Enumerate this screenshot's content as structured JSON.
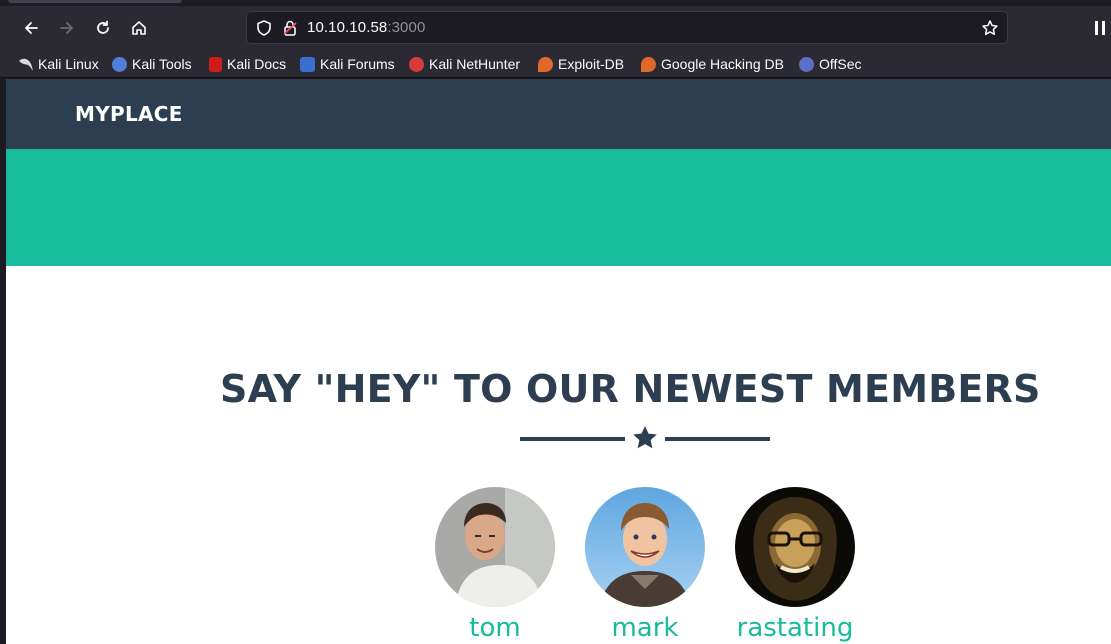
{
  "browser": {
    "url_host": "10.10.10.58",
    "url_port": ":3000",
    "bookmarks": [
      {
        "label": "Kali Linux",
        "icon": "kali-dragon-icon",
        "color": "#111111"
      },
      {
        "label": "Kali Tools",
        "icon": "kali-tools-icon",
        "color": "#4f7fd8"
      },
      {
        "label": "Kali Docs",
        "icon": "kali-docs-icon",
        "color": "#d11a1a"
      },
      {
        "label": "Kali Forums",
        "icon": "kali-forums-icon",
        "color": "#3a6fd0"
      },
      {
        "label": "Kali NetHunter",
        "icon": "nethunter-icon",
        "color": "#d83a3a"
      },
      {
        "label": "Exploit-DB",
        "icon": "exploit-db-icon",
        "color": "#e0682a"
      },
      {
        "label": "Google Hacking DB",
        "icon": "ghdb-icon",
        "color": "#e0682a"
      },
      {
        "label": "OffSec",
        "icon": "offsec-icon",
        "color": "#5a6fc8"
      }
    ]
  },
  "site": {
    "brand": "MYPLACE",
    "colors": {
      "nav": "#2c3e50",
      "hero": "#18bc9c",
      "heading": "#2c3e50",
      "member_name": "#18bc9c"
    },
    "heading": "SAY \"HEY\" TO OUR NEWEST MEMBERS",
    "members": [
      {
        "name": "tom"
      },
      {
        "name": "mark"
      },
      {
        "name": "rastating"
      }
    ]
  }
}
